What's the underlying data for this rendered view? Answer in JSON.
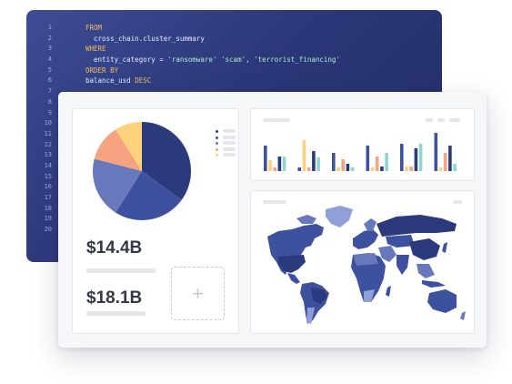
{
  "editor": {
    "line_numbers": [
      "1",
      "2",
      "3",
      "4",
      "5",
      "6",
      "7",
      "8",
      "9",
      "10",
      "11",
      "12",
      "13",
      "14",
      "15",
      "16",
      "17",
      "18",
      "19",
      "20"
    ],
    "lines": [
      [
        {
          "t": "FROM",
          "c": "kw"
        }
      ],
      [
        {
          "t": "  cross_chain.cluster_summary",
          "c": ""
        }
      ],
      [
        {
          "t": "WHERE",
          "c": "kw"
        }
      ],
      [
        {
          "t": "  entity_category = ",
          "c": ""
        },
        {
          "t": "'ransomware'",
          "c": "str"
        },
        {
          "t": " ",
          "c": ""
        },
        {
          "t": "'scam'",
          "c": "str"
        },
        {
          "t": ", ",
          "c": ""
        },
        {
          "t": "'terrorist_financing'",
          "c": "str"
        }
      ],
      [
        {
          "t": "ORDER BY",
          "c": "kw"
        }
      ],
      [
        {
          "t": "balance_usd ",
          "c": ""
        },
        {
          "t": "DESC",
          "c": "kw"
        }
      ]
    ]
  },
  "dashboard": {
    "stats": [
      {
        "value": "$14.4B"
      },
      {
        "value": "$18.1B"
      }
    ],
    "add_widget_symbol": "+",
    "pie": {
      "slices": [
        {
          "value": 35,
          "color": "#2b3a7c"
        },
        {
          "value": 24,
          "color": "#3e519e"
        },
        {
          "value": 20,
          "color": "#6878bd"
        },
        {
          "value": 12,
          "color": "#f7a381"
        },
        {
          "value": 9,
          "color": "#fdd27a"
        }
      ]
    },
    "legend_colors": [
      "#2b3a7c",
      "#3e519e",
      "#6878bd",
      "#f7a381",
      "#fdd27a"
    ],
    "bar_chart": {
      "colors": [
        "#3e519e",
        "#fdd27a",
        "#f7a381",
        "#2b3a7c",
        "#8fd6d3"
      ],
      "groups": [
        [
          28,
          12,
          4,
          16,
          16
        ],
        [
          4,
          34,
          4,
          22,
          15
        ],
        [
          20,
          4,
          13,
          8,
          4
        ],
        [
          28,
          4,
          16,
          5,
          20
        ],
        [
          30,
          5,
          5,
          25,
          30
        ],
        [
          42,
          4,
          20,
          28,
          8
        ]
      ]
    },
    "map": {
      "palette": [
        "#2b3a7c",
        "#3e519e",
        "#6878bd",
        "#8fa0d6"
      ]
    }
  }
}
